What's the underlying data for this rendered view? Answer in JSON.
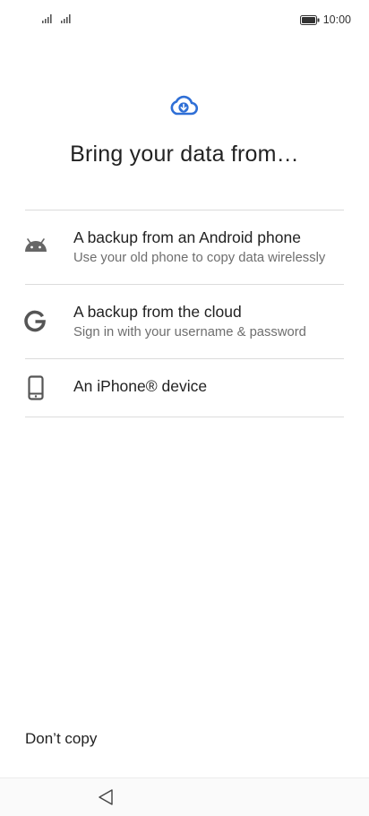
{
  "status_bar": {
    "time": "10:00"
  },
  "header": {
    "title": "Bring your data from…",
    "icon": "cloud-download-icon",
    "accent_color": "#2f6fd6"
  },
  "options": [
    {
      "icon": "android-icon",
      "title": "A backup from an Android phone",
      "subtitle": "Use your old phone to copy data wirelessly"
    },
    {
      "icon": "google-icon",
      "title": "A backup from the cloud",
      "subtitle": "Sign in with your username & password"
    },
    {
      "icon": "phone-icon",
      "title": "An iPhone® device"
    }
  ],
  "footer": {
    "dont_copy_label": "Don’t copy"
  },
  "nav_bar": {
    "back_icon": "back-triangle-icon"
  }
}
